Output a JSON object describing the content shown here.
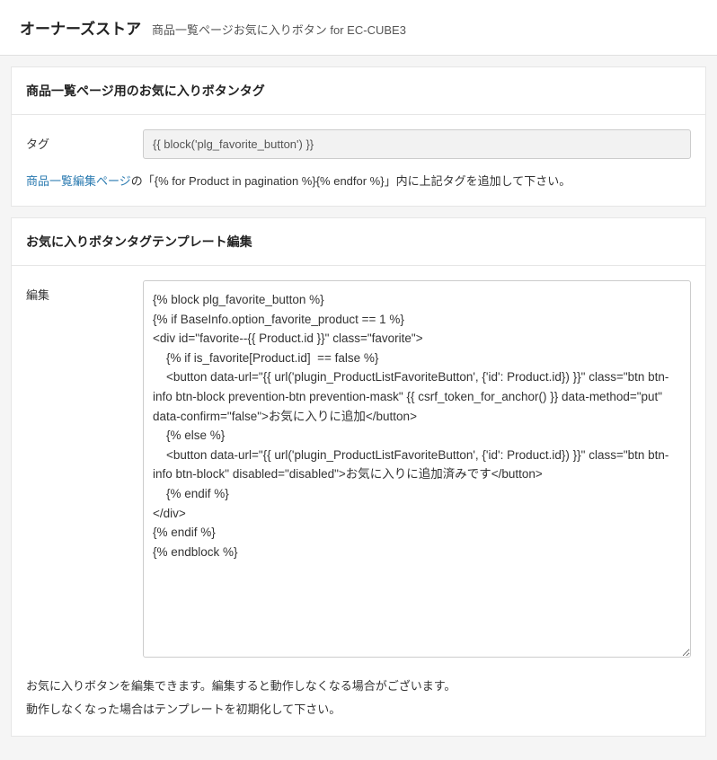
{
  "header": {
    "title": "オーナーズストア",
    "subtitle": "商品一覧ページお気に入りボタン for EC-CUBE3"
  },
  "panel1": {
    "heading": "商品一覧ページ用のお気に入りボタンタグ",
    "tag_label": "タグ",
    "tag_value": "{{ block('plg_favorite_button') }}",
    "link_text": "商品一覧編集ページ",
    "hint_rest": "の「{% for Product in pagination %}{% endfor %}」内に上記タグを追加して下さい。"
  },
  "panel2": {
    "heading": "お気に入りボタンタグテンプレート編集",
    "edit_label": "編集",
    "template_code": "{% block plg_favorite_button %}\n{% if BaseInfo.option_favorite_product == 1 %}\n<div id=\"favorite--{{ Product.id }}\" class=\"favorite\">\n    {% if is_favorite[Product.id]  == false %}\n    <button data-url=\"{{ url('plugin_ProductListFavoriteButton', {'id': Product.id}) }}\" class=\"btn btn-info btn-block prevention-btn prevention-mask\" {{ csrf_token_for_anchor() }} data-method=\"put\" data-confirm=\"false\">お気に入りに追加</button>\n    {% else %}\n    <button data-url=\"{{ url('plugin_ProductListFavoriteButton', {'id': Product.id}) }}\" class=\"btn btn-info btn-block\" disabled=\"disabled\">お気に入りに追加済みです</button>\n    {% endif %}\n</div>\n{% endif %}\n{% endblock %}",
    "desc_line1": "お気に入りボタンを編集できます。編集すると動作しなくなる場合がございます。",
    "desc_line2": "動作しなくなった場合はテンプレートを初期化して下さい。"
  }
}
